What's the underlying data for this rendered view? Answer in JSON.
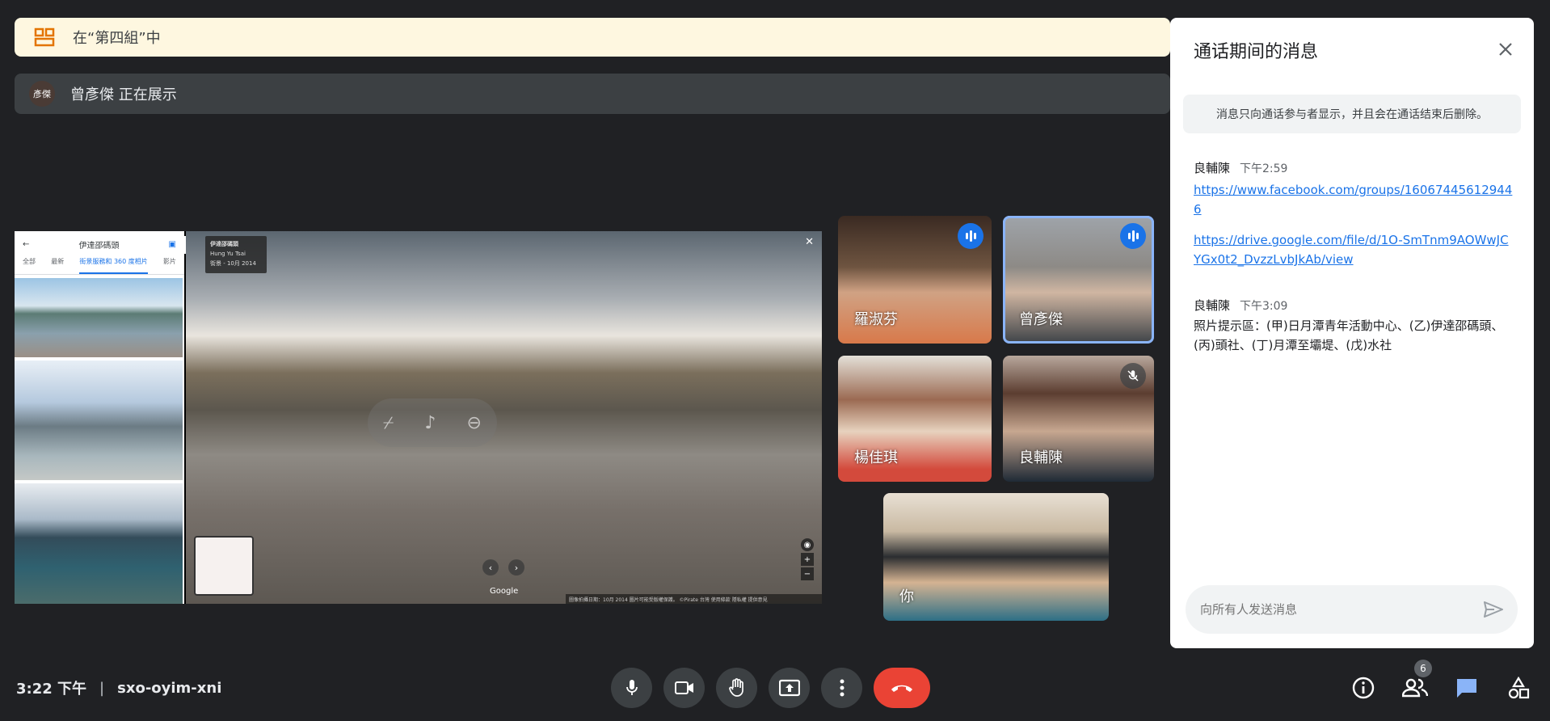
{
  "breakout": {
    "text": "在“第四組”中",
    "icon": "breakout-room-icon"
  },
  "presenting": {
    "avatar_text": "彥傑",
    "text": "曾彥傑 正在展示"
  },
  "shared_screen": {
    "panel_title": "伊達邵碼頭",
    "tabs": [
      "全部",
      "最新",
      "街景服務和 360 度相片",
      "影片"
    ],
    "sv_title": "伊達邵碼頭",
    "sv_author": "Hung Yu Tsai",
    "sv_date": "街景 - 10月 2014",
    "google_label": "Google",
    "footer": "圖像拍攝日期：10月 2014   圖片可能受版權保護。  ©Pirate   台灣   使用條款   隱私權   提供意見"
  },
  "participants": [
    {
      "name": "羅淑芬",
      "state": "speaking"
    },
    {
      "name": "曾彥傑",
      "state": "speaking"
    },
    {
      "name": "楊佳琪",
      "state": "normal"
    },
    {
      "name": "良輔陳",
      "state": "muted"
    },
    {
      "name": "你",
      "state": "normal"
    }
  ],
  "chat": {
    "title": "通话期间的消息",
    "notice": "消息只向通话参与者显示，并且会在通话结束后删除。",
    "messages": [
      {
        "sender": "良輔陳",
        "time": "下午2:59",
        "links": [
          "https://www.facebook.com/groups/160674456129446",
          "https://drive.google.com/file/d/1O-SmTnm9AOWwJCYGx0t2_DvzzLvbJkAb/view"
        ]
      },
      {
        "sender": "良輔陳",
        "time": "下午3:09",
        "body": "照片提示區：(甲)日月潭青年活動中心、(乙)伊達邵碼頭、(丙)頭社、(丁)月潭至壩堤、(戊)水社"
      }
    ],
    "input_placeholder": "向所有人发送消息"
  },
  "meeting": {
    "time": "3:22 下午",
    "separator": "|",
    "code": "sxo-oyim-xni"
  },
  "people_count": "6",
  "colors": {
    "accent": "#1a73e8",
    "hangup": "#ea4335",
    "banner": "#fef7e0"
  }
}
